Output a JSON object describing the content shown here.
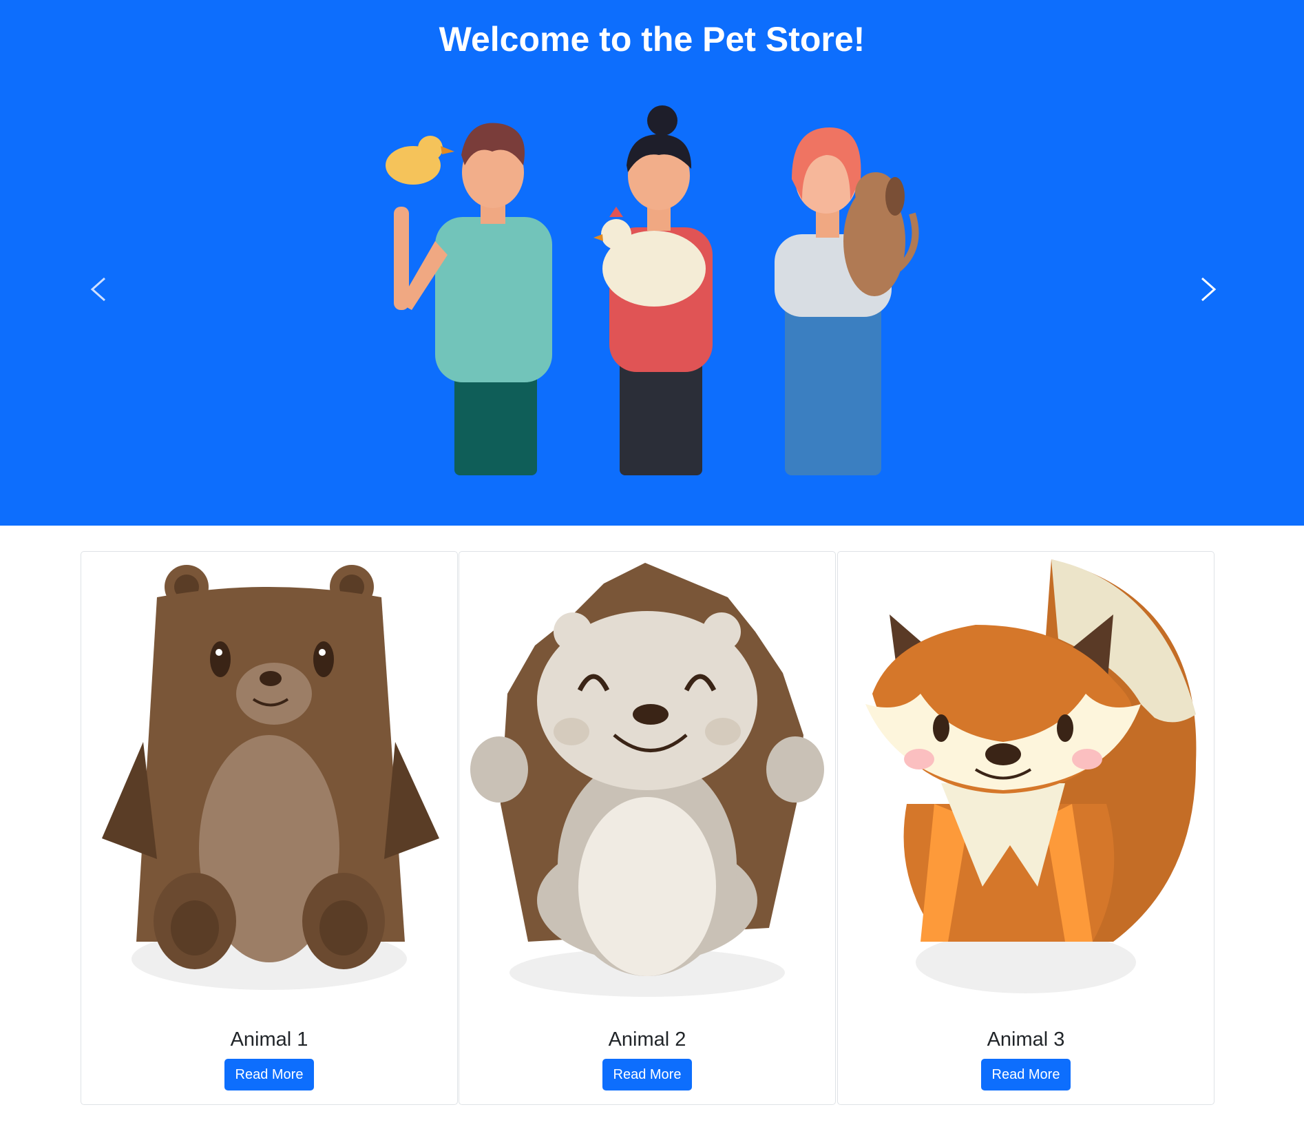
{
  "hero": {
    "title": "Welcome to the Pet Store!",
    "background_color": "#0d6efd",
    "illustration": "three-people-holding-pets",
    "prev_icon": "chevron-left-icon",
    "next_icon": "chevron-right-icon"
  },
  "cards": [
    {
      "title": "Animal 1",
      "button_label": "Read More",
      "image": "brown-bear"
    },
    {
      "title": "Animal 2",
      "button_label": "Read More",
      "image": "hedgehog"
    },
    {
      "title": "Animal 3",
      "button_label": "Read More",
      "image": "fox"
    }
  ],
  "colors": {
    "primary": "#0d6efd",
    "card_border": "#dee2e6",
    "text": "#212529"
  }
}
